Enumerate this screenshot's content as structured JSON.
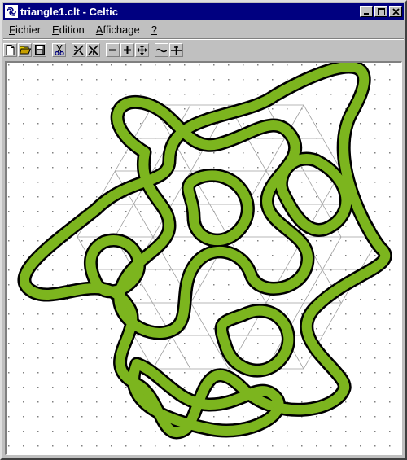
{
  "window": {
    "title": "triangle1.clt - Celtic",
    "minimize_label": "_",
    "maximize_label": "□",
    "close_label": "×"
  },
  "menu": {
    "items": [
      {
        "first": "F",
        "rest": "ichier"
      },
      {
        "first": "E",
        "rest": "dition"
      },
      {
        "first": "A",
        "rest": "ffichage"
      },
      {
        "first": "?",
        "rest": ""
      }
    ]
  },
  "toolbar": {
    "icons": [
      "new-file-icon",
      "open-folder-icon",
      "save-disk-icon",
      "cut-scissors-icon",
      "knot-cross-left-icon",
      "knot-cross-right-icon",
      "zoom-out-icon",
      "zoom-in-icon",
      "move-icon",
      "break-line-icon",
      "cross-line-icon"
    ]
  },
  "colors": {
    "knot_fill": "#7cb51e",
    "knot_outline": "#000000",
    "grid_line": "#a0a0a0",
    "dot": "#808080",
    "title_bar": "#000080"
  }
}
